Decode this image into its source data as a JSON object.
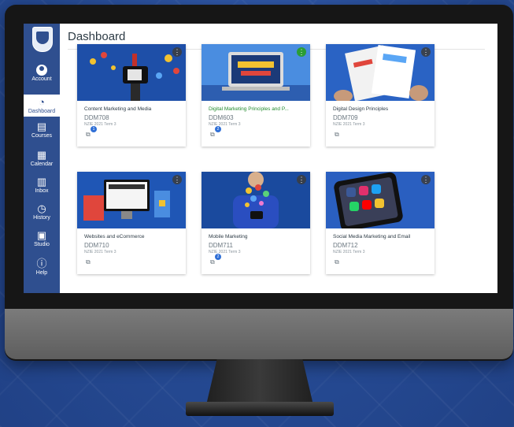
{
  "header": {
    "title": "Dashboard"
  },
  "sidebar": {
    "items": [
      {
        "label": "Account",
        "icon": "account-icon"
      },
      {
        "label": "Dashboard",
        "icon": "dashboard-icon"
      },
      {
        "label": "Courses",
        "icon": "courses-icon"
      },
      {
        "label": "Calendar",
        "icon": "calendar-icon"
      },
      {
        "label": "Inbox",
        "icon": "inbox-icon"
      },
      {
        "label": "History",
        "icon": "history-icon"
      },
      {
        "label": "Studio",
        "icon": "studio-icon"
      },
      {
        "label": "Help",
        "icon": "help-icon"
      }
    ]
  },
  "cards": [
    {
      "name": "Content Marketing and Media",
      "code": "DDM708",
      "term": "NZIE 2021 Term 3",
      "badge": "1"
    },
    {
      "name": "Digital Marketing Principles and P...",
      "code": "DDM603",
      "term": "NZIE 2021 Term 3",
      "badge": "2"
    },
    {
      "name": "Digital Design Principles",
      "code": "DDM709",
      "term": "NZIE 2021 Term 3",
      "badge": ""
    },
    {
      "name": "Websites and eCommerce",
      "code": "DDM710",
      "term": "NZIE 2021 Term 3",
      "badge": ""
    },
    {
      "name": "Mobile Marketing",
      "code": "DDM711",
      "term": "NZIE 2021 Term 3",
      "badge": "2"
    },
    {
      "name": "Social Media Marketing and Email",
      "code": "DDM712",
      "term": "NZIE 2021 Term 3",
      "badge": ""
    }
  ],
  "colors": {
    "sidebar": "#2f4f8f",
    "accent_green": "#238b2e",
    "background": "#2a4f9c"
  }
}
